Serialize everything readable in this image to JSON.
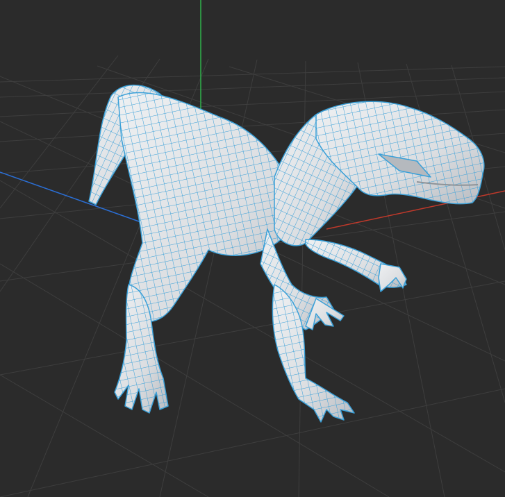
{
  "viewport": {
    "background_color": "#2b2b2b",
    "grid_color": "#3d3d3d",
    "axis_colors": {
      "x_axis": "#c0392b",
      "y_axis": "#2fb24a",
      "z_axis": "#2b6fd6"
    }
  },
  "model": {
    "object": "raptor-dinosaur-mesh",
    "display_mode": "shaded-with-wireframe",
    "surface_color": "#e2e3e5",
    "wireframe_color": "#3aa0d8"
  }
}
